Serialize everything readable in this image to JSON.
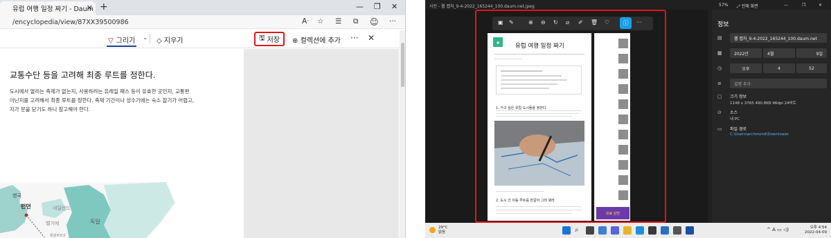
{
  "browser": {
    "tab_title": "유럽 여행 일정 짜기 - Daum 백과",
    "url": "/encyclopedia/view/87XX39500986",
    "pdf_toolbar": {
      "draw": "그리기",
      "erase": "지우기",
      "save": "저장",
      "add_to_collection": "컬렉션에 추가"
    },
    "page": {
      "heading": "교통수단 등을 고려해 최종 루트를 정한다.",
      "lines": [
        "도시에서 열리는 축제가 없는지, 사용하려는 유레일 패스 등이 유효한 곳인지, 교통편",
        "아닌지를 고려해서 최종 루트를 정한다. 축제 기간이나 성수기에는 숙소 잡기가 어렵고,",
        "지가 문을 닫기도 하니 참고해야 한다."
      ],
      "map_labels": [
        "영국",
        "런던",
        "네덜란드",
        "벨기에",
        "독일",
        "룩셈부르크"
      ]
    }
  },
  "photos": {
    "window_title": "사진 - 웹 캡처_9-4-2022_165244_100.daum.net.jpeg",
    "zoom": "57%",
    "fullscreen": "전체 화면",
    "doc": {
      "title": "유럽 여행 일정 짜기",
      "section1": "1. 가고 싶은 유럽 도시들을 정한다.",
      "section2": "2. 도시 간 이동 루트를 번갈아 그려 봐라.",
      "banner": "유료 강연"
    },
    "info": {
      "title": "정보",
      "filename": "웹 캡처_9-4-2022_165244_100.daum.net",
      "year": "2022년",
      "month": "4월",
      "day": "9일",
      "ampm": "오후",
      "hour": "4",
      "minute": "52",
      "description_placeholder": "설명 추가",
      "size_label": "크기 정보",
      "size_value": "1148 x 3765   490.8KB   96dpi   24비트",
      "source_label": "소스",
      "source_value": "내 PC",
      "path_label": "파일 경로",
      "path_value": "C:\\Users\\archmond\\Downloads"
    },
    "taskbar": {
      "temperature": "29°C",
      "weather": "맑음",
      "time": "오후 4:54",
      "date": "2022-04-09",
      "lang": "A"
    }
  },
  "colors": {
    "highlight": "#e0141a",
    "accent_blue": "#1a9fe8",
    "map_green": "#7fc8c0"
  }
}
